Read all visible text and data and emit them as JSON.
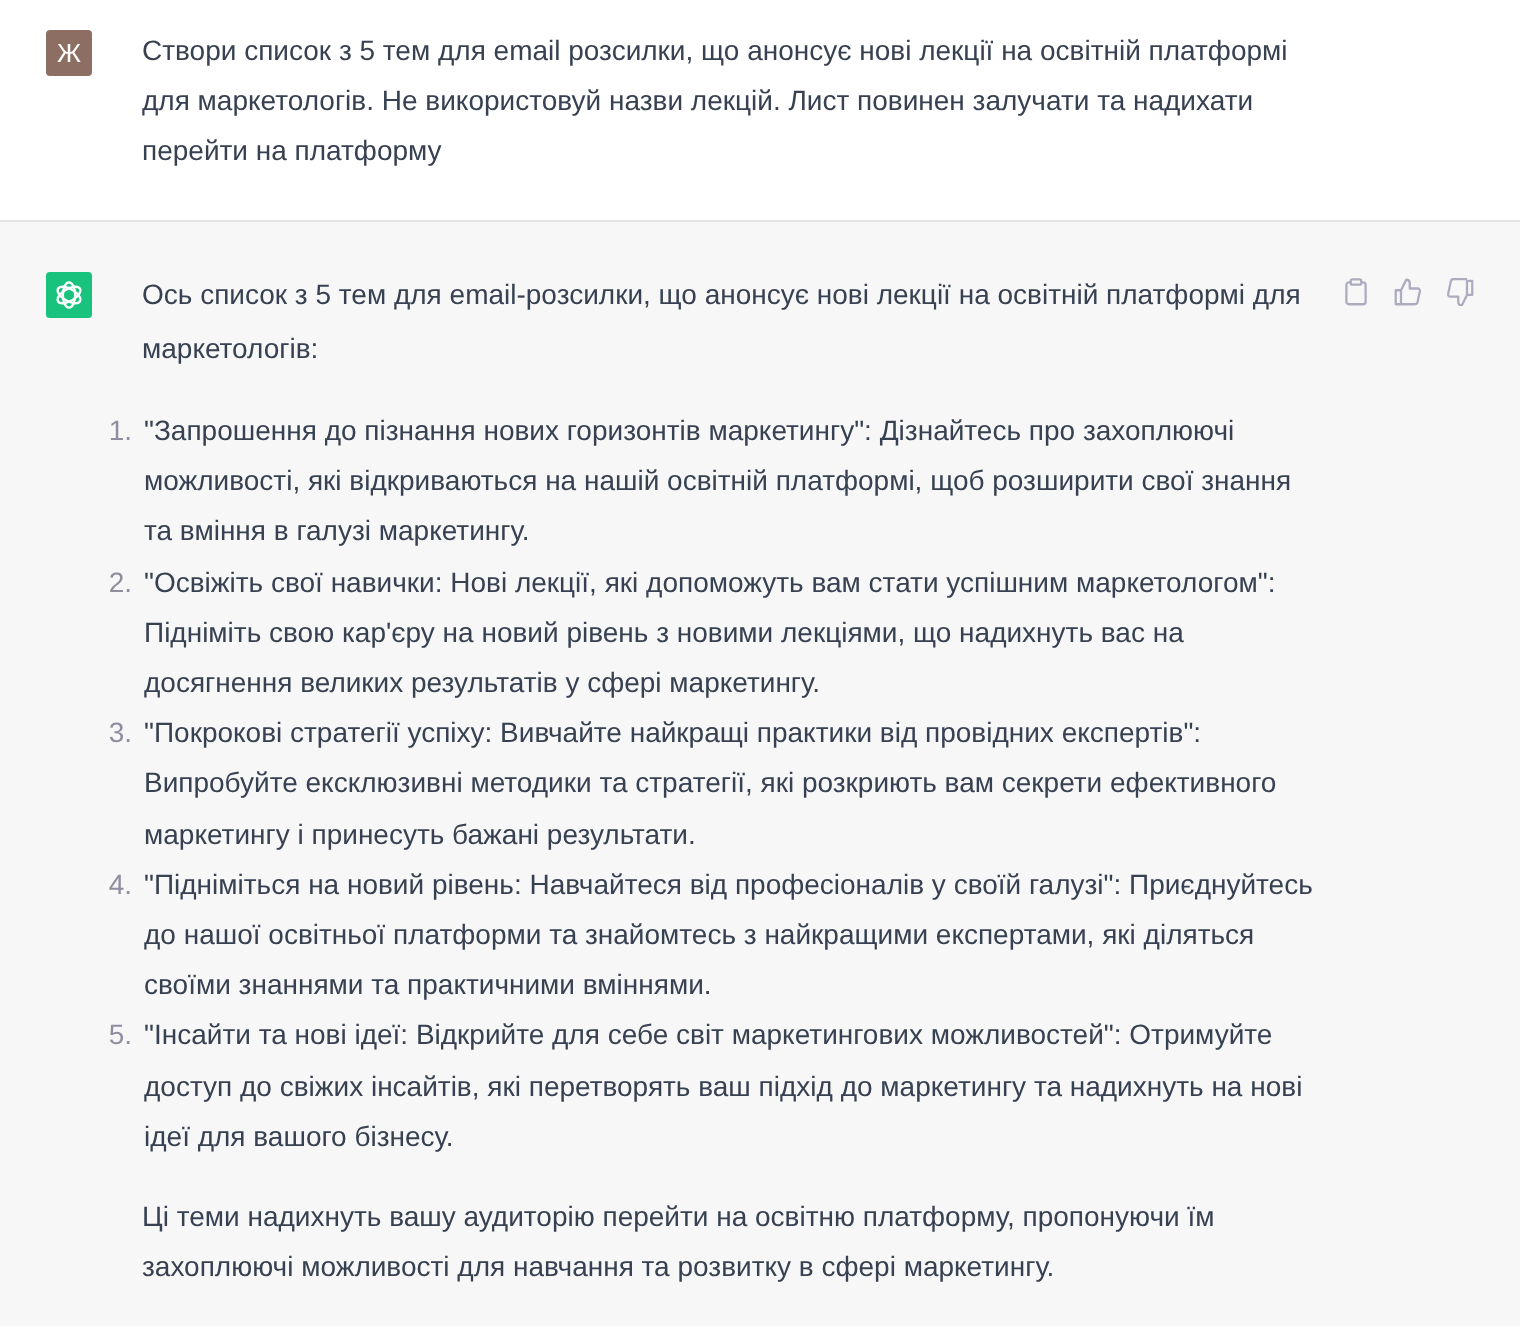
{
  "user_message": {
    "avatar_letter": "Ж",
    "text": "Створи список з 5 тем для email розсилки, що анонсує нові лекції на освітній платформі для маркетологів. Не використовуй назви лекцій. Лист повинен залучати та надихати перейти на платформу"
  },
  "assistant_message": {
    "intro": "Ось список з 5 тем для email-розсилки, що анонсує нові лекції на освітній платформі для маркетологів:",
    "items": [
      {
        "number": "1.",
        "text": "\"Запрошення до пізнання нових горизонтів маркетингу\": Дізнайтесь про захоплюючі можливості, які відкриваються на нашій освітній платформі, щоб розширити свої знання та вміння в галузі маркетингу."
      },
      {
        "number": "2.",
        "text": "\"Освіжіть свої навички: Нові лекції, які допоможуть вам стати успішним маркетологом\": Підніміть свою кар'єру на новий рівень з новими лекціями, що надихнуть вас на досягнення великих результатів у сфері маркетингу."
      },
      {
        "number": "3.",
        "text": "\"Покрокові стратегії успіху: Вивчайте найкращі практики від провідних експертів\": Випробуйте ексклюзивні методики та стратегії, які розкриють вам секрети ефективного маркетингу і принесуть бажані результати."
      },
      {
        "number": "4.",
        "text": "\"Підніміться на новий рівень: Навчайтеся від професіоналів у своїй галузі\": Приєднуйтесь до нашої освітньої платформи та знайомтесь з найкращими експертами, які діляться своїми знаннями та практичними вміннями."
      },
      {
        "number": "5.",
        "text": "\"Інсайти та нові ідеї: Відкрийте для себе світ маркетингових можливостей\": Отримуйте доступ до свіжих інсайтів, які перетворять ваш підхід до маркетингу та надихнуть на нові ідеї для вашого бізнесу."
      }
    ],
    "outro": "Ці теми надихнуть вашу аудиторію перейти на освітню платформу, пропонуючи їм захоплюючі можливості для навчання та розвитку в сфері маркетингу."
  }
}
